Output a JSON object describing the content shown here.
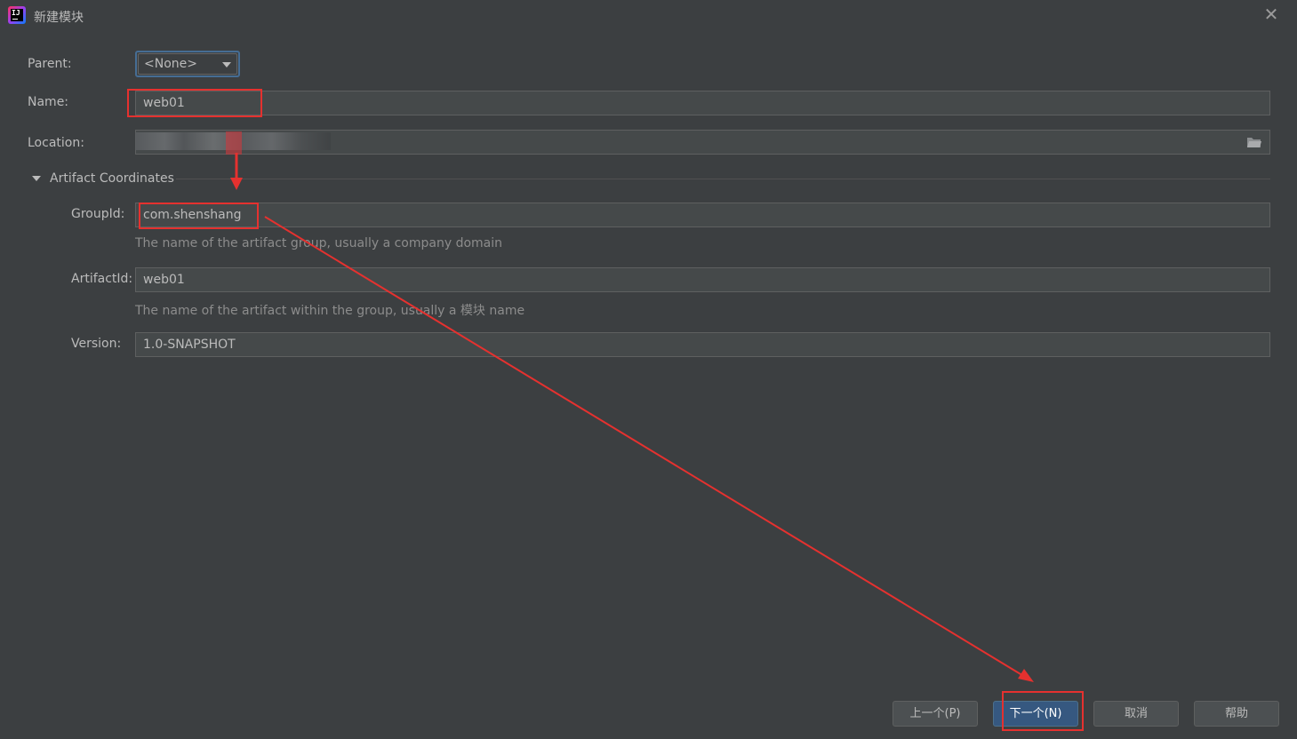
{
  "window": {
    "title": "新建模块",
    "close_glyph": "✕"
  },
  "form": {
    "parent": {
      "label": "Parent:",
      "value": "<None>"
    },
    "name": {
      "label": "Name:",
      "value": "web01"
    },
    "location": {
      "label": "Location:",
      "value": ""
    },
    "artifact_section": {
      "label": "Artifact Coordinates"
    },
    "group_id": {
      "label": "GroupId:",
      "value": "com.shenshang",
      "hint": "The name of the artifact group, usually a company domain"
    },
    "artifact_id": {
      "label": "ArtifactId:",
      "value": "web01",
      "hint": "The name of the artifact within the group, usually a 模块 name"
    },
    "version": {
      "label": "Version:",
      "value": "1.0-SNAPSHOT"
    }
  },
  "buttons": {
    "previous": "上一个(P)",
    "next": "下一个(N)",
    "cancel": "取消",
    "help": "帮助"
  },
  "colors": {
    "background": "#3c3f41",
    "field": "#45494a",
    "primary_button": "#365880",
    "annotation": "#e5312f"
  },
  "icons": {
    "app": "intellij-logo-icon",
    "close": "close-icon",
    "browse": "folder-icon",
    "dropdown": "chevron-down-icon",
    "collapse": "triangle-down-icon"
  }
}
